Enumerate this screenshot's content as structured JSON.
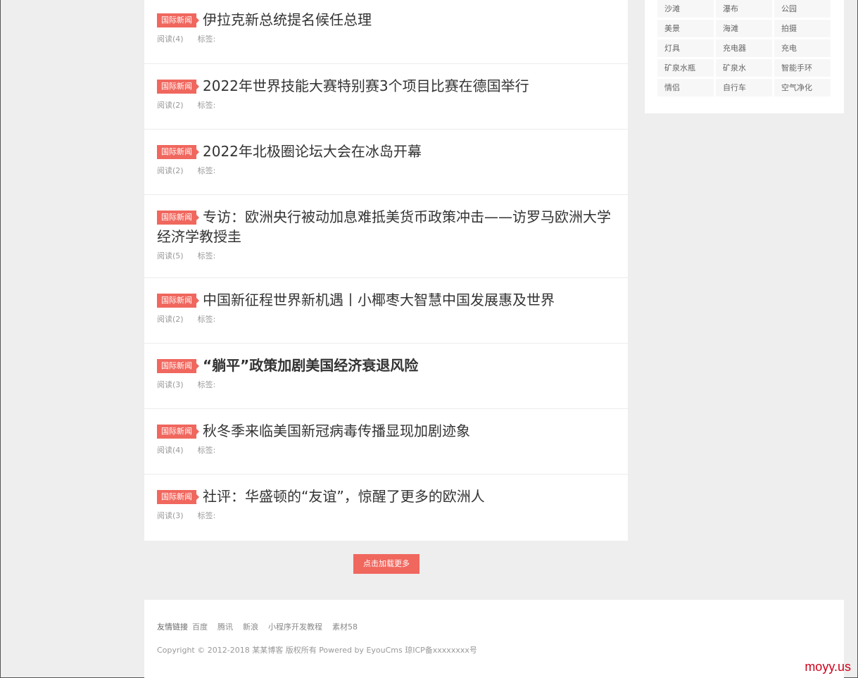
{
  "articles": [
    {
      "badge": "国际新闻",
      "title": "伊拉克新总统提名候任总理",
      "reads": "阅读(4)",
      "tags_label": "标签:",
      "bold": false
    },
    {
      "badge": "国际新闻",
      "title": "2022年世界技能大赛特别赛3个项目比赛在德国举行",
      "reads": "阅读(2)",
      "tags_label": "标签:",
      "bold": false
    },
    {
      "badge": "国际新闻",
      "title": "2022年北极圈论坛大会在冰岛开幕",
      "reads": "阅读(2)",
      "tags_label": "标签:",
      "bold": false
    },
    {
      "badge": "国际新闻",
      "title": "专访：欧洲央行被动加息难抵美货币政策冲击——访罗马欧洲大学经济学教授圭",
      "reads": "阅读(5)",
      "tags_label": "标签:",
      "bold": false
    },
    {
      "badge": "国际新闻",
      "title": "中国新征程世界新机遇丨小椰枣大智慧中国发展惠及世界",
      "reads": "阅读(2)",
      "tags_label": "标签:",
      "bold": false
    },
    {
      "badge": "国际新闻",
      "title": "“躺平”政策加剧美国经济衰退风险",
      "reads": "阅读(3)",
      "tags_label": "标签:",
      "bold": true
    },
    {
      "badge": "国际新闻",
      "title": "秋冬季来临美国新冠病毒传播显现加剧迹象",
      "reads": "阅读(4)",
      "tags_label": "标签:",
      "bold": false
    },
    {
      "badge": "国际新闻",
      "title": "社评：华盛顿的“友谊”，惊醒了更多的欧洲人",
      "reads": "阅读(3)",
      "tags_label": "标签:",
      "bold": false
    }
  ],
  "load_more_label": "点击加载更多",
  "tags": [
    "沙滩",
    "瀑布",
    "公园",
    "美景",
    "海滩",
    "拍摄",
    "灯具",
    "充电器",
    "充电",
    "矿泉水瓶",
    "矿泉水",
    "智能手环",
    "情侣",
    "自行车",
    "空气净化"
  ],
  "footer": {
    "links_label": "友情链接",
    "links": [
      "百度",
      "腾讯",
      "新浪",
      "小程序开发教程",
      "素材58"
    ],
    "copyright": "Copyright © 2012-2018 某某博客 版权所有 Powered by EyouCms 琼ICP备xxxxxxxx号"
  },
  "watermark": "moyy.us",
  "colors": {
    "accent": "#f0675e",
    "background": "#eeeeee"
  }
}
